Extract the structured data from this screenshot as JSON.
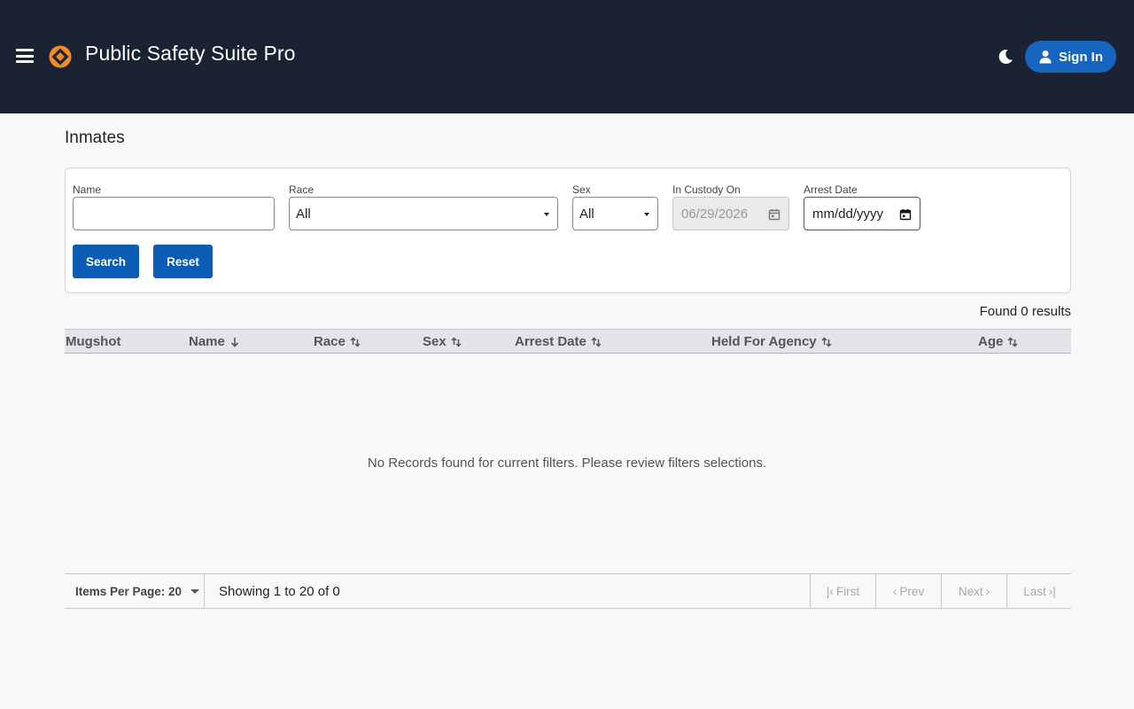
{
  "header": {
    "title": "Public Safety Suite Pro",
    "menu_icon": "hamburger-menu-icon",
    "theme_icon": "moon-icon",
    "sign_in_label": "Sign In",
    "brand_color": "#1b2333",
    "accent_color": "#f28c28"
  },
  "page": {
    "title": "Inmates"
  },
  "filters": {
    "name_label": "Name",
    "name_value": "",
    "race_label": "Race",
    "race_value": "All",
    "sex_label": "Sex",
    "sex_value": "All",
    "custody_label": "In Custody On",
    "custody_value": "06/29/2026",
    "arrest_label": "Arrest Date",
    "arrest_value": "mm/dd/yyyy",
    "search_label": "Search",
    "reset_label": "Reset"
  },
  "results": {
    "found_text": "Found 0 results",
    "empty_text": "No Records found for current filters. Please review filters selections."
  },
  "table": {
    "columns": [
      {
        "label": "Mugshot",
        "sort": "none"
      },
      {
        "label": "Name",
        "sort": "desc"
      },
      {
        "label": "Race",
        "sort": "sortable"
      },
      {
        "label": "Sex",
        "sort": "sortable"
      },
      {
        "label": "Arrest Date",
        "sort": "sortable"
      },
      {
        "label": "Held For Agency",
        "sort": "sortable"
      },
      {
        "label": "Age",
        "sort": "sortable"
      }
    ]
  },
  "pagination": {
    "items_per_page_label": "Items Per Page: 20",
    "showing_text": "Showing 1 to 20 of 0",
    "first_label": "First",
    "prev_label": "Prev",
    "next_label": "Next",
    "last_label": "Last"
  }
}
